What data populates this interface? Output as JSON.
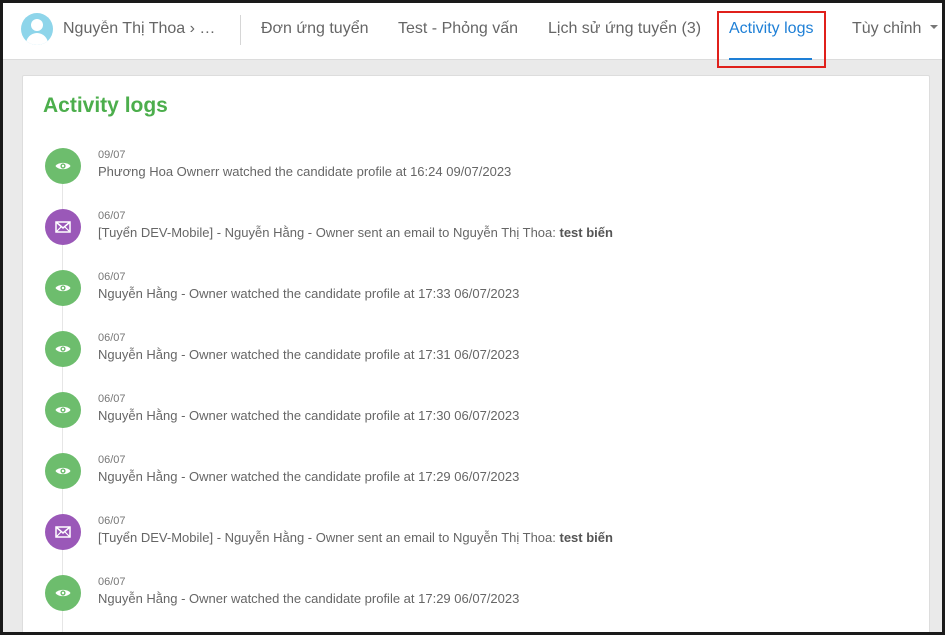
{
  "header": {
    "breadcrumb": "Nguyễn Thị Thoa › Ho…",
    "tabs": [
      {
        "label": "Đơn ứng tuyển",
        "active": false
      },
      {
        "label": "Test - Phỏng vấn",
        "active": false
      },
      {
        "label": "Lịch sử ứng tuyển (3)",
        "active": false
      },
      {
        "label": "Activity logs",
        "active": true
      },
      {
        "label": "Tùy chỉnh",
        "active": false
      }
    ]
  },
  "main": {
    "title": "Activity logs",
    "entries": [
      {
        "icon": "eye-icon",
        "date": "09/07",
        "text": "Phương Hoa Ownerr watched the candidate profile at 16:24 09/07/2023",
        "bold": ""
      },
      {
        "icon": "envelope-icon",
        "date": "06/07",
        "text": "[Tuyển DEV-Mobile] - Nguyễn Hằng - Owner sent an email to Nguyễn Thị Thoa: ",
        "bold": "test biến"
      },
      {
        "icon": "eye-icon",
        "date": "06/07",
        "text": "Nguyễn Hằng - Owner watched the candidate profile at 17:33 06/07/2023",
        "bold": ""
      },
      {
        "icon": "eye-icon",
        "date": "06/07",
        "text": "Nguyễn Hằng - Owner watched the candidate profile at 17:31 06/07/2023",
        "bold": ""
      },
      {
        "icon": "eye-icon",
        "date": "06/07",
        "text": "Nguyễn Hằng - Owner watched the candidate profile at 17:30 06/07/2023",
        "bold": ""
      },
      {
        "icon": "eye-icon",
        "date": "06/07",
        "text": "Nguyễn Hằng - Owner watched the candidate profile at 17:29 06/07/2023",
        "bold": ""
      },
      {
        "icon": "envelope-icon",
        "date": "06/07",
        "text": "[Tuyển DEV-Mobile] - Nguyễn Hằng - Owner sent an email to Nguyễn Thị Thoa: ",
        "bold": "test biến"
      },
      {
        "icon": "eye-icon",
        "date": "06/07",
        "text": "Nguyễn Hằng - Owner watched the candidate profile at 17:29 06/07/2023",
        "bold": ""
      }
    ]
  },
  "colors": {
    "accent": "#1e7fd6",
    "title_green": "#4cae4c",
    "view_dot": "#6dbd6d",
    "mail_dot": "#9a58b8",
    "highlight_box": "#e0201b"
  }
}
